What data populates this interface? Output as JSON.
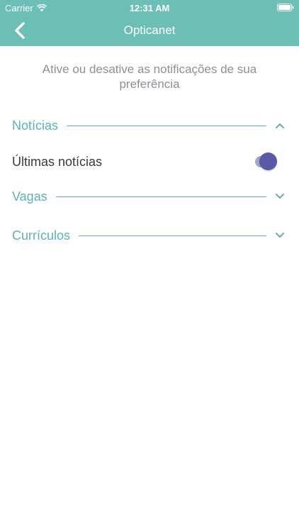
{
  "status_bar": {
    "carrier": "Carrier",
    "time": "12:31 AM",
    "wifi_icon": "wifi-icon",
    "battery_icon": "battery-icon"
  },
  "nav": {
    "title": "Opticanet",
    "back_icon": "chevron-left-icon"
  },
  "intro_text": "Ative ou desative as notificações de sua preferência",
  "sections": [
    {
      "label": "Notícias",
      "expanded": true,
      "chevron": "chevron-up-icon"
    },
    {
      "label": "Vagas",
      "expanded": false,
      "chevron": "chevron-down-icon"
    },
    {
      "label": "Currículos",
      "expanded": false,
      "chevron": "chevron-down-icon"
    }
  ],
  "settings": [
    {
      "label": "Últimas notícias",
      "enabled": true
    }
  ],
  "colors": {
    "header": "#6bbfb5",
    "accent": "#5bb3b5",
    "toggle_on": "#575ba6"
  }
}
